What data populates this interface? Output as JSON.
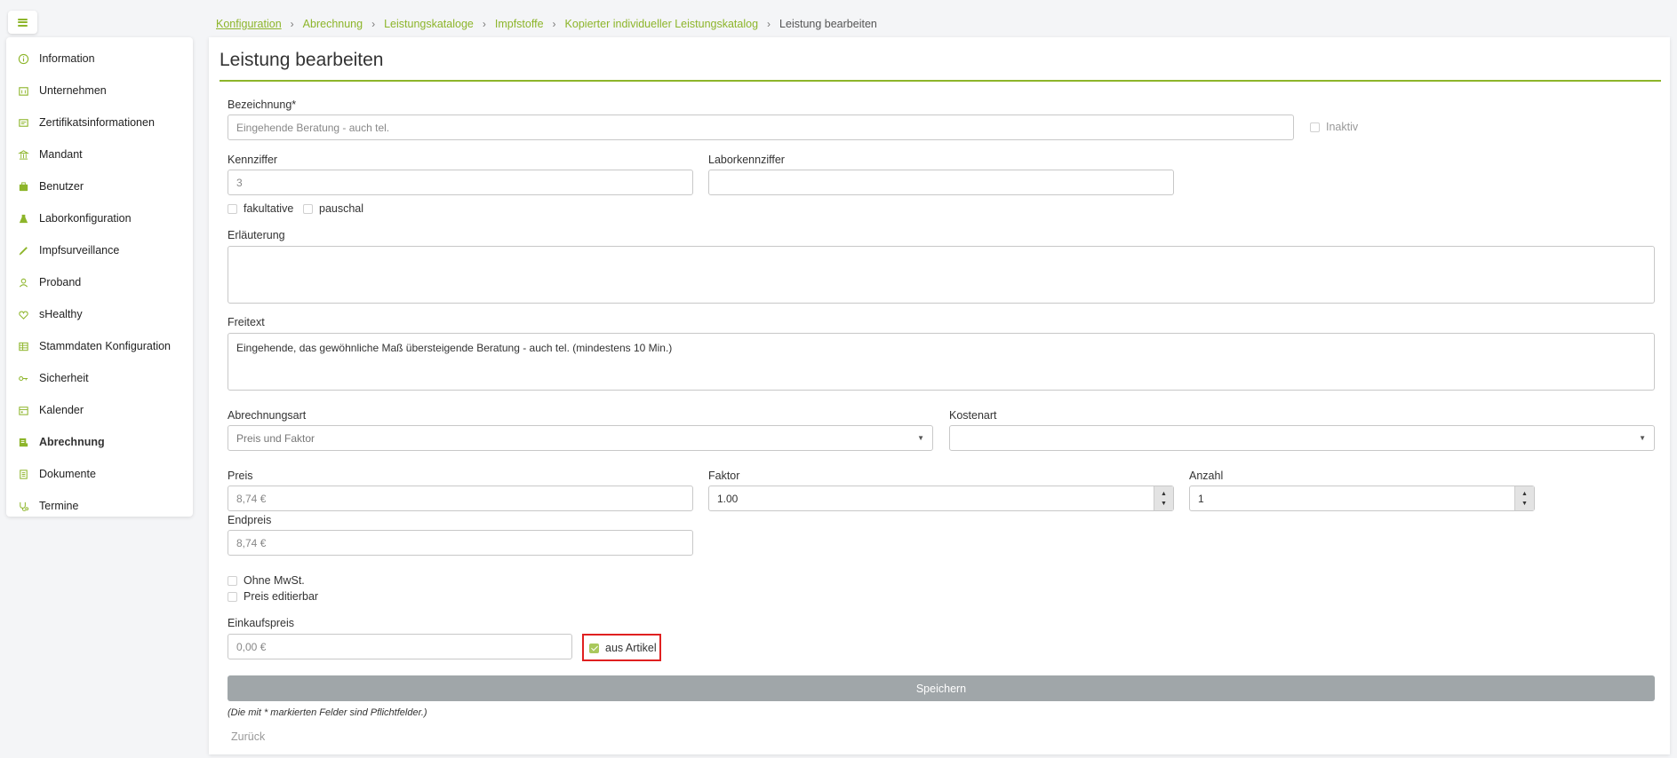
{
  "sidebar": {
    "items": [
      {
        "label": "Information",
        "icon": "info-icon"
      },
      {
        "label": "Unternehmen",
        "icon": "building-icon"
      },
      {
        "label": "Zertifikatsinformationen",
        "icon": "certificate-icon"
      },
      {
        "label": "Mandant",
        "icon": "bank-icon"
      },
      {
        "label": "Benutzer",
        "icon": "users-icon"
      },
      {
        "label": "Laborkonfiguration",
        "icon": "flask-icon"
      },
      {
        "label": "Impfsurveillance",
        "icon": "syringe-icon"
      },
      {
        "label": "Proband",
        "icon": "person-icon"
      },
      {
        "label": "sHealthy",
        "icon": "heart-icon"
      },
      {
        "label": "Stammdaten Konfiguration",
        "icon": "table-icon"
      },
      {
        "label": "Sicherheit",
        "icon": "key-icon"
      },
      {
        "label": "Kalender",
        "icon": "calendar-icon"
      },
      {
        "label": "Abrechnung",
        "icon": "billing-icon"
      },
      {
        "label": "Dokumente",
        "icon": "document-icon"
      },
      {
        "label": "Termine",
        "icon": "stethoscope-icon"
      }
    ],
    "active": "Abrechnung"
  },
  "breadcrumb": {
    "items": [
      "Konfiguration",
      "Abrechnung",
      "Leistungskataloge",
      "Impfstoffe",
      "Kopierter individueller Leistungskatalog"
    ],
    "current": "Leistung bearbeiten"
  },
  "page": {
    "title": "Leistung bearbeiten"
  },
  "form": {
    "bezeichnung_label": "Bezeichnung*",
    "bezeichnung_value": "Eingehende Beratung - auch tel.",
    "inaktiv_label": "Inaktiv",
    "kennziffer_label": "Kennziffer",
    "kennziffer_value": "3",
    "laborkennziffer_label": "Laborkennziffer",
    "laborkennziffer_value": "",
    "fakultative_label": "fakultative",
    "pauschal_label": "pauschal",
    "erlaeuterung_label": "Erläuterung",
    "erlaeuterung_value": "",
    "freitext_label": "Freitext",
    "freitext_value": "Eingehende, das gewöhnliche Maß übersteigende Beratung - auch tel. (mindestens 10 Min.)",
    "abrechnungsart_label": "Abrechnungsart",
    "abrechnungsart_value": "Preis und Faktor",
    "kostenart_label": "Kostenart",
    "kostenart_value": "",
    "preis_label": "Preis",
    "preis_value": "8,74 €",
    "faktor_label": "Faktor",
    "faktor_value": "1.00",
    "anzahl_label": "Anzahl",
    "anzahl_value": "1",
    "endpreis_label": "Endpreis",
    "endpreis_value": "8,74 €",
    "ohne_mwst_label": "Ohne MwSt.",
    "preis_editierbar_label": "Preis editierbar",
    "einkaufspreis_label": "Einkaufspreis",
    "einkaufspreis_value": "0,00 €",
    "aus_artikel_label": "aus Artikel",
    "aus_artikel_checked": true,
    "save_label": "Speichern",
    "hint": "(Die mit * markierten Felder sind Pflichtfelder.)",
    "back_label": "Zurück"
  },
  "colors": {
    "accent": "#8db52a",
    "highlight": "#e02020",
    "button": "#a0a6a9"
  }
}
